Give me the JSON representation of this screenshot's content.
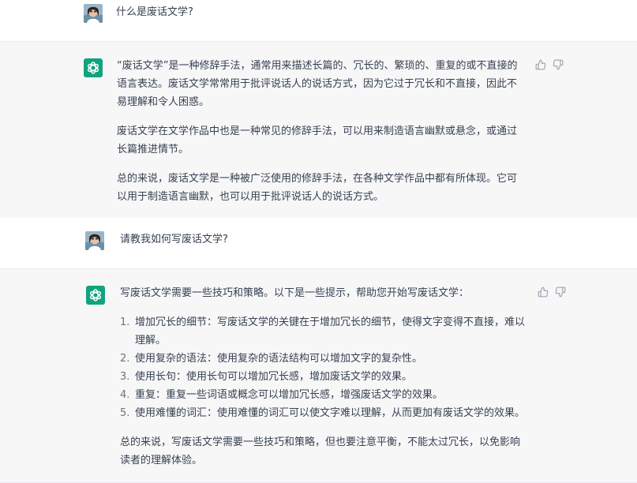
{
  "conversation": {
    "q1": "什么是废话文学?",
    "a1": {
      "p1": "“废话文学”是一种修辞手法，通常用来描述长篇的、冗长的、繁琐的、重复的或不直接的语言表达。废话文学常常用于批评说话人的说话方式，因为它过于冗长和不直接，因此不易理解和令人困惑。",
      "p2": "废话文学在文学作品中也是一种常见的修辞手法，可以用来制造语言幽默或悬念，或通过长篇推进情节。",
      "p3": "总的来说，废话文学是一种被广泛使用的修辞手法，在各种文学作品中都有所体现。它可以用于制造语言幽默，也可以用于批评说话人的说话方式。"
    },
    "q2": "请教我如何写废话文学?",
    "a2": {
      "intro": "写废话文学需要一些技巧和策略。以下是一些提示，帮助您开始写废话文学：",
      "steps": [
        {
          "num": "1.",
          "text": "增加冗长的细节：写废话文学的关键在于增加冗长的细节，使得文字变得不直接，难以理解。"
        },
        {
          "num": "2.",
          "text": "使用复杂的语法：使用复杂的语法结构可以增加文字的复杂性。"
        },
        {
          "num": "3.",
          "text": "使用长句：使用长句可以增加冗长感，增加废话文学的效果。"
        },
        {
          "num": "4.",
          "text": "重复：重复一些词语或概念可以增加冗长感，增强废话文学的效果。"
        },
        {
          "num": "5.",
          "text": "使用难懂的词汇：使用难懂的词汇可以使文字难以理解，从而更加有废话文学的效果。"
        }
      ],
      "outro": "总的来说，写废话文学需要一些技巧和策略，但也要注意平衡，不能太过冗长，以免影响读者的理解体验。"
    }
  },
  "icons": {
    "user_avatar": "user-avatar",
    "assistant_logo": "openai-logo-icon",
    "like": "thumbs-up-icon",
    "dislike": "thumbs-down-icon"
  },
  "colors": {
    "assistant_bg": "#10a37f",
    "bot_row_bg": "#f7f7f8",
    "text": "#374151"
  }
}
